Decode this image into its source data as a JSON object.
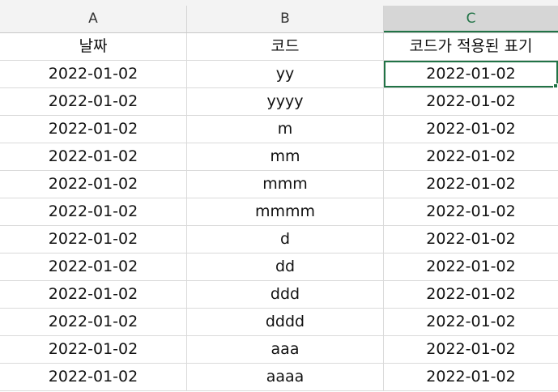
{
  "columns": [
    "A",
    "B",
    "C"
  ],
  "active_column": "C",
  "accent_color": "#217346",
  "rows": [
    {
      "a": "날짜",
      "b": "코드",
      "c": "코드가 적용된 표기"
    },
    {
      "a": "2022-01-02",
      "b": "yy",
      "c": "2022-01-02"
    },
    {
      "a": "2022-01-02",
      "b": "yyyy",
      "c": "2022-01-02"
    },
    {
      "a": "2022-01-02",
      "b": "m",
      "c": "2022-01-02"
    },
    {
      "a": "2022-01-02",
      "b": "mm",
      "c": "2022-01-02"
    },
    {
      "a": "2022-01-02",
      "b": "mmm",
      "c": "2022-01-02"
    },
    {
      "a": "2022-01-02",
      "b": "mmmm",
      "c": "2022-01-02"
    },
    {
      "a": "2022-01-02",
      "b": "d",
      "c": "2022-01-02"
    },
    {
      "a": "2022-01-02",
      "b": "dd",
      "c": "2022-01-02"
    },
    {
      "a": "2022-01-02",
      "b": "ddd",
      "c": "2022-01-02"
    },
    {
      "a": "2022-01-02",
      "b": "dddd",
      "c": "2022-01-02"
    },
    {
      "a": "2022-01-02",
      "b": "aaa",
      "c": "2022-01-02"
    },
    {
      "a": "2022-01-02",
      "b": "aaaa",
      "c": "2022-01-02"
    }
  ]
}
